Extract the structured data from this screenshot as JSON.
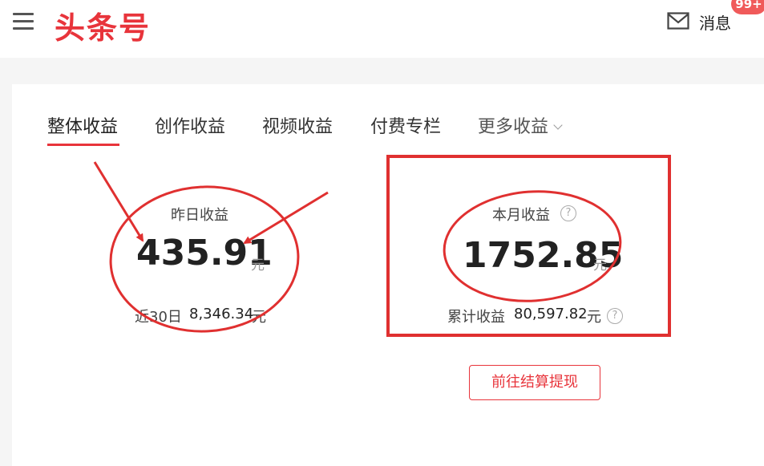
{
  "header": {
    "logo": "头条号",
    "messages_label": "消息",
    "messages_badge": "99+"
  },
  "tabs": [
    {
      "label": "整体收益",
      "active": true
    },
    {
      "label": "创作收益"
    },
    {
      "label": "视频收益"
    },
    {
      "label": "付费专栏"
    },
    {
      "label": "更多收益"
    }
  ],
  "yesterday": {
    "label": "昨日收益",
    "value": "435.91",
    "unit": "元",
    "recent_label": "近30日",
    "recent_value": "8,346.34",
    "recent_unit": "元"
  },
  "month": {
    "label": "本月收益",
    "value": "1752.85",
    "unit": "元",
    "total_label": "累计收益",
    "total_value": "80,597.82",
    "total_unit": "元"
  },
  "withdraw_button": "前往结算提现",
  "colors": {
    "brand": "#e8343b",
    "annotation": "#e03030"
  },
  "icons": [
    "menu-icon",
    "mail-icon",
    "help-icon",
    "chevron-down-icon"
  ]
}
